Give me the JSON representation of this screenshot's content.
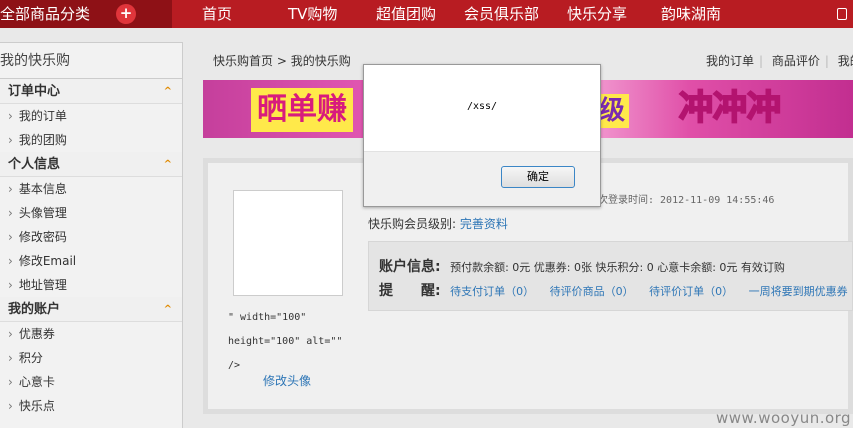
{
  "topnav": {
    "category_label": "全部商品分类",
    "plus_symbol": "+",
    "items": [
      "首页",
      "TV购物",
      "超值团购",
      "会员俱乐部",
      "快乐分享",
      "韵味湖南"
    ]
  },
  "sidebar": {
    "title": "我的快乐购",
    "sections": [
      {
        "title": "订单中心",
        "items": [
          "我的订单",
          "我的团购"
        ]
      },
      {
        "title": "个人信息",
        "items": [
          "基本信息",
          "头像管理",
          "修改密码",
          "修改Email",
          "地址管理"
        ]
      },
      {
        "title": "我的账户",
        "items": [
          "优惠券",
          "积分",
          "心意卡",
          "快乐点"
        ]
      }
    ],
    "caret_symbol": "^"
  },
  "breadcrumb": {
    "home": "快乐购首页",
    "sep": ">",
    "current": "我的快乐购"
  },
  "toplinks": [
    "我的订单",
    "商品评价",
    "我的"
  ],
  "banner": {
    "left_text": "晒单",
    "partial": "赚",
    "mid_text": "级",
    "right_text": "冲冲冲"
  },
  "profile": {
    "broken_img_text": "\" width=\"100\" height=\"100\" alt=\"\" />",
    "edit_avatar": "修改头像",
    "last_login": "次登录时间: 2012-11-09 14:55:46",
    "level_label": "快乐购会员级别:",
    "level_link": "完善资料"
  },
  "account": {
    "info_label": "账户信息:",
    "info_values": "预付款余额: 0元  优惠券: 0张  快乐积分: 0  心意卡余额: 0元  有效订购",
    "remind_label": "提　　醒:",
    "remind_links": [
      "待支付订单（0）",
      "待评价商品（0）",
      "待评价订单（0）",
      "一周将要到期优惠券"
    ]
  },
  "modal": {
    "message": "/xss/",
    "ok_label": "确定"
  },
  "watermark": "www.wooyun.org"
}
